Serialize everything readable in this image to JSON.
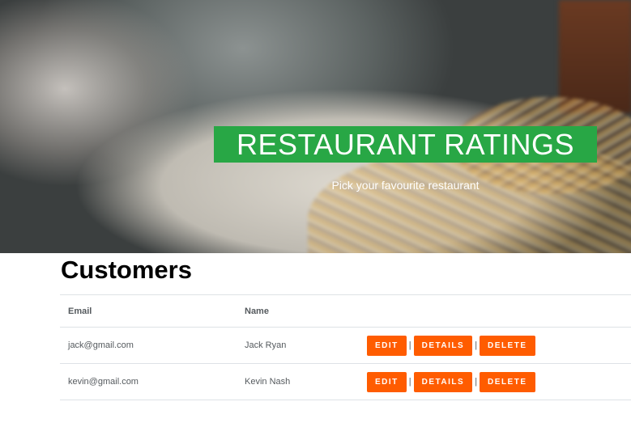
{
  "hero": {
    "title": "RESTAURANT RATINGS",
    "subtitle": "Pick your favourite restaurant",
    "title_bg_color": "#28a745"
  },
  "page": {
    "heading": "Customers"
  },
  "table": {
    "columns": [
      "Email",
      "Name",
      ""
    ],
    "rows": [
      {
        "email": "jack@gmail.com",
        "name": "Jack Ryan"
      },
      {
        "email": "kevin@gmail.com",
        "name": "Kevin Nash"
      }
    ]
  },
  "actions": {
    "edit_label": "EDIT",
    "details_label": "DETAILS",
    "delete_label": "DELETE",
    "separator": "|",
    "button_color": "#ff5c00"
  }
}
